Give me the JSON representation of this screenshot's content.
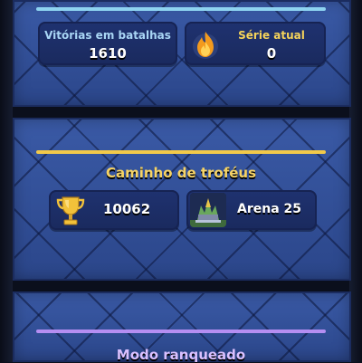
{
  "battle_stats": {
    "wins_label": "Vitórias em batalhas",
    "wins_value": "1610",
    "streak_label": "Série atual",
    "streak_value": "0",
    "streak_icon": "flame-icon"
  },
  "trophy_road": {
    "title": "Caminho de troféus",
    "trophies": "10062",
    "trophy_icon": "trophy-icon",
    "arena_label": "Arena 25"
  },
  "ranked": {
    "title": "Modo ranqueado"
  },
  "colors": {
    "panel_blue": "#2d4b93",
    "accent_gold": "#f2c94a",
    "accent_cyan": "#8ed3f0",
    "accent_purple": "#b58ef2"
  }
}
